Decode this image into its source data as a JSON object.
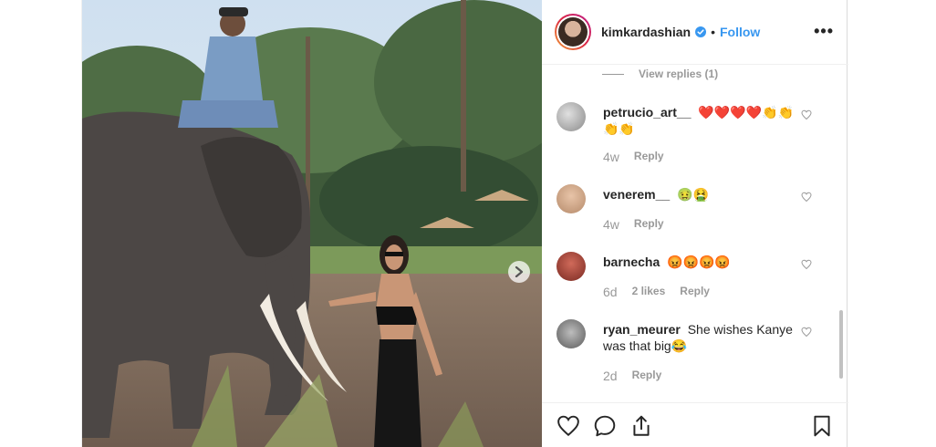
{
  "header": {
    "username": "kimkardashian",
    "separator": "•",
    "follow_label": "Follow",
    "more_label": "•••",
    "verified_color": "#3897f0"
  },
  "view_replies": "View replies (1)",
  "comments": [
    {
      "user": "petrucio_art__",
      "text": "❤️❤️❤️❤️👏👏👏👏",
      "time": "4w",
      "likes": "",
      "reply": "Reply"
    },
    {
      "user": "venerem__",
      "text": "🤢🤮",
      "time": "4w",
      "likes": "",
      "reply": "Reply"
    },
    {
      "user": "barnecha",
      "text": "😡😡😡😡",
      "time": "6d",
      "likes": "2 likes",
      "reply": "Reply"
    },
    {
      "user": "ryan_meurer",
      "text": "She wishes Kanye was that big😂",
      "time": "2d",
      "likes": "",
      "reply": "Reply"
    }
  ],
  "icons": {
    "like": "heart-icon",
    "comment": "comment-icon",
    "share": "share-icon",
    "save": "bookmark-icon",
    "next": "chevron-right-icon"
  },
  "colors": {
    "accent": "#3897f0",
    "muted": "#999999",
    "text": "#262626",
    "heart_red": "#e0245e"
  }
}
